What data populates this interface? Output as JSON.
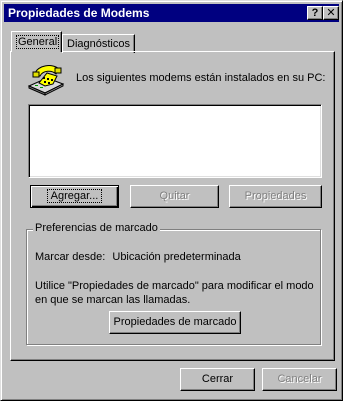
{
  "window": {
    "title": "Propiedades de Modems",
    "help_button": "?",
    "close_button": "✕"
  },
  "tabs": [
    {
      "label": "General",
      "selected": true
    },
    {
      "label": "Diagnósticos",
      "selected": false
    }
  ],
  "general": {
    "intro_text": "Los siguientes modems están instalados en su PC:",
    "modems": [],
    "buttons": {
      "add": "Agregar...",
      "remove": "Quitar",
      "properties": "Propiedades"
    }
  },
  "dialing_prefs": {
    "title": "Preferencias de marcado",
    "dial_from_label": "Marcar desde:",
    "dial_from_value": "Ubicación predeterminada",
    "help_text": "Utilice \"Propiedades de marcado\" para modificar el modo en que se marcan las llamadas.",
    "button": "Propiedades de marcado"
  },
  "footer": {
    "close": "Cerrar",
    "cancel": "Cancelar"
  },
  "icons": {
    "modem": "phone-modem-icon"
  },
  "colors": {
    "titlebar": "#000080",
    "face": "#c0c0c0"
  }
}
